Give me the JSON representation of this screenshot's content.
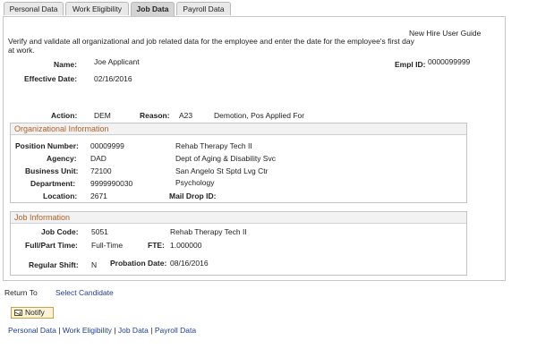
{
  "tabs": [
    "Personal Data",
    "Work Eligibility",
    "Job Data",
    "Payroll Data"
  ],
  "guide_link": "New Hire User Guide",
  "instructions": "Verify and validate all organizational and job related data for the employee and enter the date for the employee's first day at work.",
  "header": {
    "name_label": "Name:",
    "name_value": "Joe Applicant",
    "emplid_label": "Empl ID:",
    "emplid_value": "0000099999",
    "effdate_label": "Effective Date:",
    "effdate_value": "02/16/2016"
  },
  "action": {
    "action_label": "Action:",
    "action_value": "DEM",
    "reason_label": "Reason:",
    "reason_code": "A23",
    "reason_desc": "Demotion, Pos Applied For"
  },
  "org_info": {
    "title": "Organizational Information",
    "position_label": "Position Number:",
    "position_value": "00009999",
    "position_desc": "Rehab Therapy Tech II",
    "agency_label": "Agency:",
    "agency_value": "DAD",
    "agency_desc": "Dept of Aging & Disability Svc",
    "bu_label": "Business Unit:",
    "bu_value": "72100",
    "bu_desc": "San Angelo St Sptd Lvg Ctr",
    "dept_label": "Department:",
    "dept_value": "9999990030",
    "dept_desc": "Psychology",
    "location_label": "Location:",
    "location_value": "2671",
    "maildrop_label": "Mail Drop ID:",
    "maildrop_value": ""
  },
  "job_info": {
    "title": "Job Information",
    "jobcode_label": "Job Code:",
    "jobcode_value": "5051",
    "jobcode_desc": "Rehab Therapy Tech II",
    "fullpart_label": "Full/Part Time:",
    "fullpart_value": "Full-Time",
    "fte_label": "FTE:",
    "fte_value": "1.000000",
    "shift_label": "Regular Shift:",
    "shift_value": "N",
    "probation_label": "Probation Date:",
    "probation_value": "08/16/2016"
  },
  "return_to_label": "Return To",
  "select_candidate": "Select Candidate",
  "notify_button": "Notify",
  "bottom_links": [
    "Personal Data",
    "Work Eligibility",
    "Job Data",
    "Payroll Data"
  ],
  "bottom_sep": " | "
}
